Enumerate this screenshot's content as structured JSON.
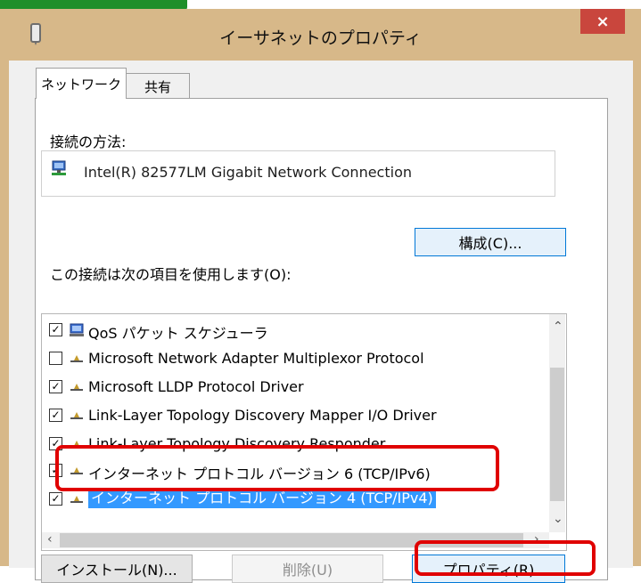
{
  "window": {
    "title": "イーサネットのプロパティ",
    "close_label": "×"
  },
  "tabs": [
    {
      "label": "ネットワーク",
      "active": true
    },
    {
      "label": "共有",
      "active": false
    }
  ],
  "connection": {
    "label": "接続の方法:",
    "adapter": "Intel(R) 82577LM Gigabit Network Connection",
    "configure_label": "構成(C)..."
  },
  "items_section": {
    "label": "この接続は次の項目を使用します(O):"
  },
  "items": [
    {
      "label": "QoS パケット スケジューラ",
      "checked": true,
      "icon": "qos-icon"
    },
    {
      "label": "Microsoft Network Adapter Multiplexor Protocol",
      "checked": false,
      "icon": "protocol-icon"
    },
    {
      "label": "Microsoft LLDP Protocol Driver",
      "checked": true,
      "icon": "protocol-icon"
    },
    {
      "label": "Link-Layer Topology Discovery Mapper I/O Driver",
      "checked": true,
      "icon": "protocol-icon"
    },
    {
      "label": "Link-Layer Topology Discovery Responder",
      "checked": true,
      "icon": "protocol-icon"
    },
    {
      "label": "インターネット プロトコル バージョン 6 (TCP/IPv6)",
      "checked": true,
      "icon": "protocol-icon"
    },
    {
      "label": "インターネット プロトコル バージョン 4 (TCP/IPv4)",
      "checked": true,
      "icon": "protocol-icon",
      "selected": true
    }
  ],
  "buttons": {
    "install": "インストール(N)...",
    "remove": "削除(U)",
    "properties": "プロパティ(R)"
  },
  "colors": {
    "selection": "#3399ff",
    "highlight": "#e00000",
    "close": "#c9463d",
    "window_frame": "#d7b889"
  }
}
